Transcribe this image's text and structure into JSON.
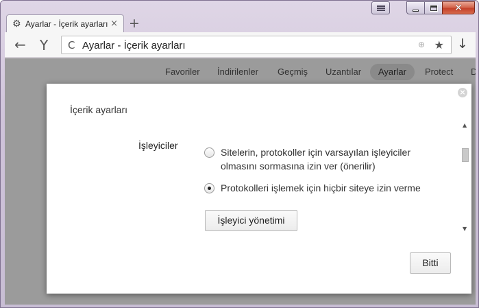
{
  "window": {
    "tab_title": "Ayarlar - İçerik ayarları",
    "tab_icon": "gear-icon",
    "new_tab_glyph": "+",
    "close_tab_glyph": "×"
  },
  "toolbar": {
    "url": "Ayarlar - İçerik ayarları",
    "back_glyph": "←",
    "yandex_glyph": "Y",
    "reload_glyph": "C",
    "globe_glyph": "⊕",
    "star_glyph": "★",
    "download_glyph": "↓"
  },
  "settings_nav": {
    "items": [
      "Favoriler",
      "İndirilenler",
      "Geçmiş",
      "Uzantılar",
      "Ayarlar",
      "Protect",
      "D"
    ],
    "active": "Ayarlar"
  },
  "dialog": {
    "title": "İçerik ayarları",
    "section_label": "İşleyiciler",
    "options": [
      {
        "label": "Sitelerin, protokoller için varsayılan işleyiciler olmasını sormasına izin ver (önerilir)",
        "checked": false
      },
      {
        "label": "Protokolleri işlemek için hiçbir siteye izin verme",
        "checked": true
      }
    ],
    "manage_button": "İşleyici yönetimi",
    "done_button": "Bitti",
    "close_glyph": "×"
  },
  "colors": {
    "overlay": "#9b9b9b",
    "frame": "#cfc3da",
    "close_button": "#c4412a"
  }
}
